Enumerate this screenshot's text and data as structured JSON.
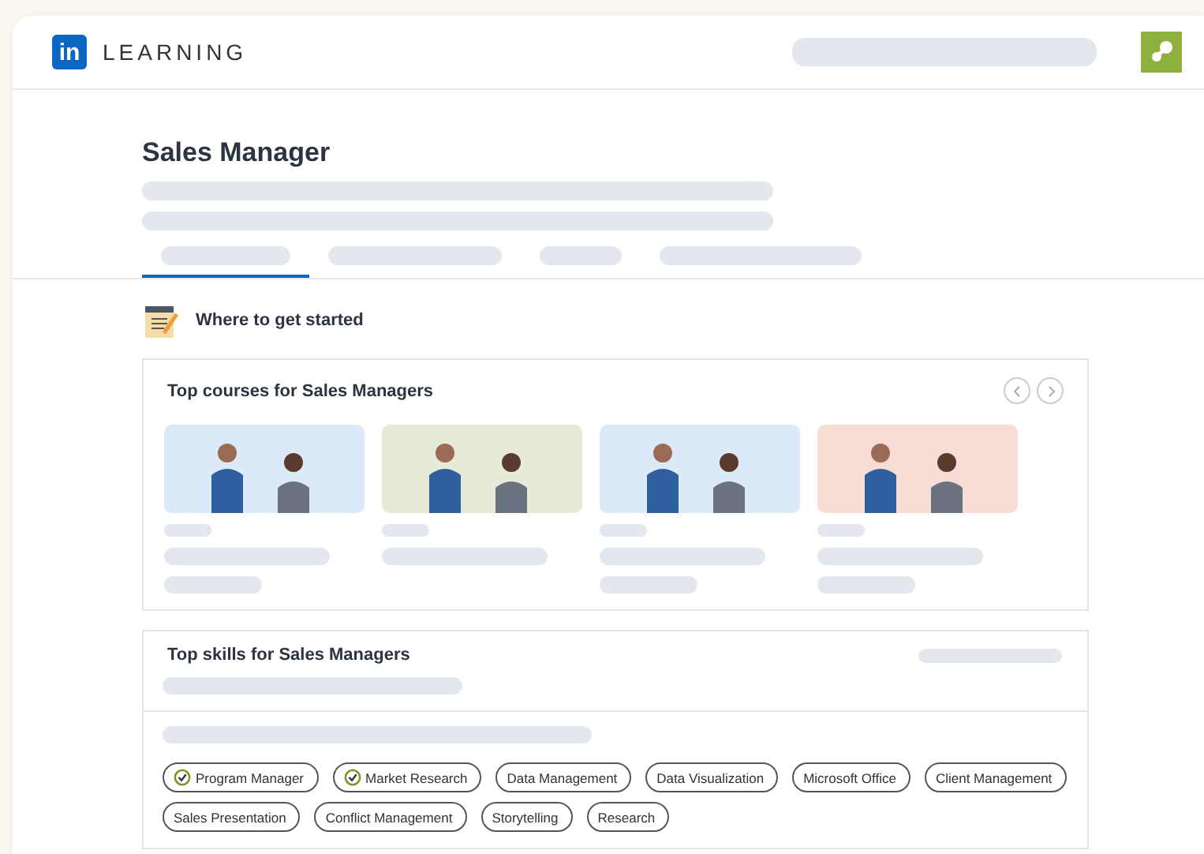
{
  "header": {
    "logo": "in",
    "brand": "LEARNING"
  },
  "page": {
    "title": "Sales Manager"
  },
  "tabs": [
    {
      "selected": true
    },
    {
      "selected": false
    },
    {
      "selected": false
    },
    {
      "selected": false
    }
  ],
  "started": {
    "label": "Where to get started"
  },
  "courses": {
    "title": "Top courses for Sales Managers",
    "items": [
      {
        "color": "#dce9f8"
      },
      {
        "color": "#e6ead8"
      },
      {
        "color": "#dce9f8"
      },
      {
        "color": "#f7ddd6"
      }
    ]
  },
  "skills": {
    "title": "Top skills for Sales Managers",
    "items": [
      {
        "label": "Program Manager",
        "checked": true
      },
      {
        "label": "Market Research",
        "checked": true
      },
      {
        "label": "Data Management",
        "checked": false
      },
      {
        "label": "Data Visualization",
        "checked": false
      },
      {
        "label": "Microsoft Office",
        "checked": false
      },
      {
        "label": "Client Management",
        "checked": false
      },
      {
        "label": "Sales Presentation",
        "checked": false
      },
      {
        "label": "Conflict Management",
        "checked": false
      },
      {
        "label": "Storytelling",
        "checked": false
      },
      {
        "label": "Research",
        "checked": false
      }
    ]
  }
}
